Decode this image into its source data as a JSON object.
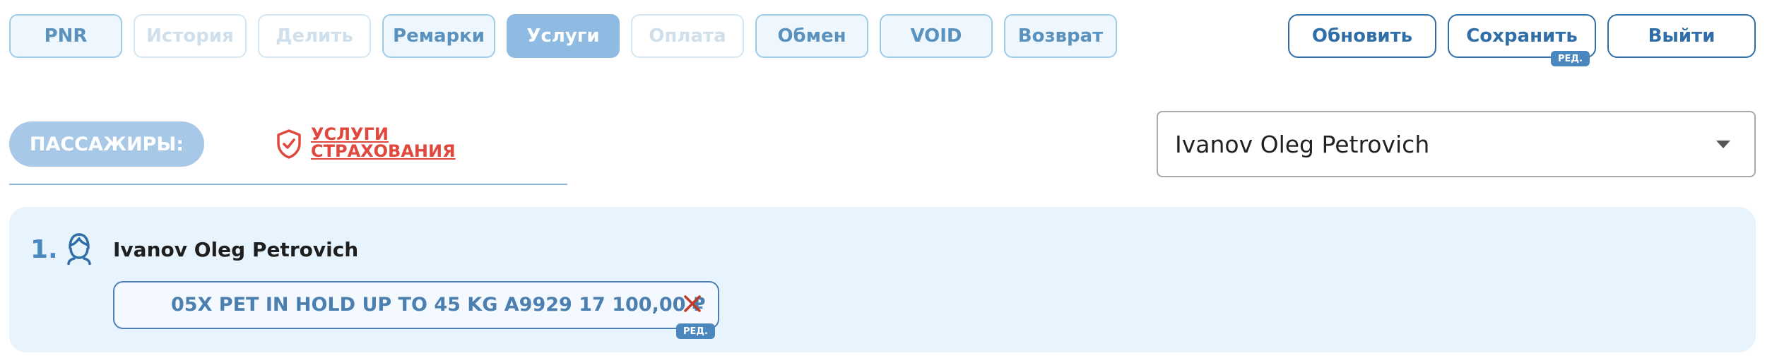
{
  "tabs": [
    {
      "label": "PNR",
      "state": "normal"
    },
    {
      "label": "История",
      "state": "disabled"
    },
    {
      "label": "Делить",
      "state": "disabled"
    },
    {
      "label": "Ремарки",
      "state": "normal"
    },
    {
      "label": "Услуги",
      "state": "active"
    },
    {
      "label": "Оплата",
      "state": "disabled"
    },
    {
      "label": "Обмен",
      "state": "normal"
    },
    {
      "label": "VOID",
      "state": "normal"
    },
    {
      "label": "Возврат",
      "state": "normal"
    }
  ],
  "actions": {
    "refresh": "Обновить",
    "save": "Сохранить",
    "save_badge": "РЕД.",
    "exit": "Выйти"
  },
  "passengers_label": "ПАССАЖИРЫ:",
  "insurance": {
    "line1": "УСЛУГИ",
    "line2": "СТРАХОВАНИЯ",
    "icon": "shield-check-icon"
  },
  "passenger_select": {
    "value": "Ivanov Oleg Petrovich"
  },
  "passenger": {
    "number": "1.",
    "name": "Ivanov Oleg Petrovich",
    "service": "05X PET IN HOLD UP TO 45 KG A9929 17 100,00 ₽",
    "service_badge": "РЕД."
  },
  "colors": {
    "accent": "#2f6ea6",
    "active_tab": "#8fbbe2",
    "danger": "#e0483d",
    "panel": "#e8f4fd"
  }
}
